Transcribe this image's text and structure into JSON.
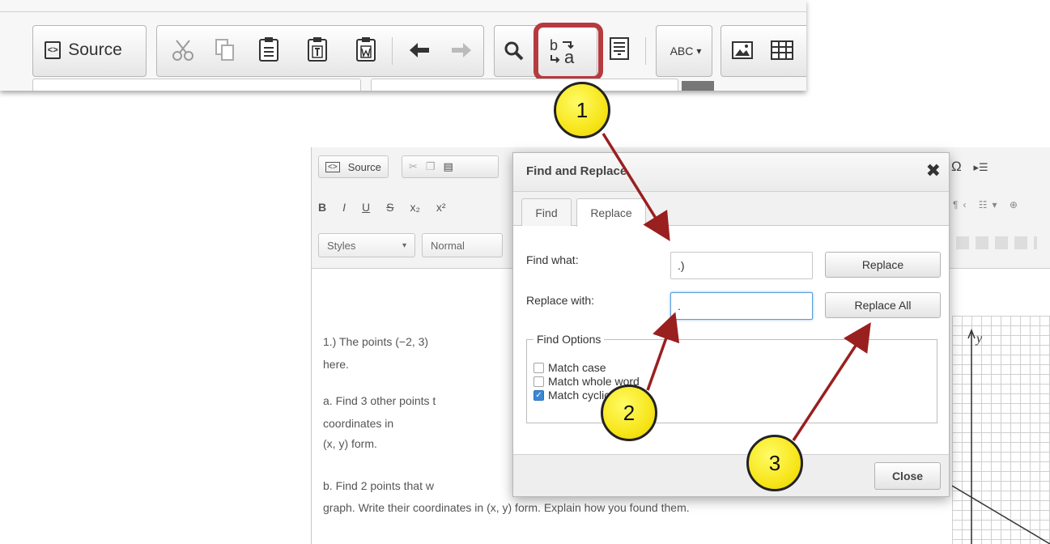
{
  "top_toolbar": {
    "source_label": "Source",
    "spell_label": "ABC"
  },
  "editor": {
    "source_label": "Source",
    "styles_label": "Styles",
    "format_label": "Normal",
    "format_row_letters": [
      "B",
      "I",
      "U",
      "S",
      "x₂",
      "x²"
    ],
    "omega": "Ω",
    "doc_lines": [
      "1.)        The points (−2, 3)",
      "here.",
      "a.        Find 3 other points t",
      "coordinates in",
      "(x, y) form.",
      "b.        Find 2 points that w",
      "graph. Write their coordinates in (x, y) form. Explain how you found them."
    ],
    "graph_axis_label": "y"
  },
  "dialog": {
    "title": "Find and Replace",
    "close_glyph": "✖",
    "tabs": [
      "Find",
      "Replace"
    ],
    "find_label": "Find what:",
    "find_value": ".)",
    "replace_label": "Replace with:",
    "replace_value": ".",
    "replace_button": "Replace",
    "replace_all_button": "Replace All",
    "options_legend": "Find Options",
    "options": [
      {
        "label": "Match case",
        "checked": false
      },
      {
        "label": "Match whole word",
        "checked": false
      },
      {
        "label": "Match cyclic",
        "checked": true
      }
    ],
    "close_button": "Close"
  },
  "callouts": [
    "1",
    "2",
    "3"
  ],
  "colors": {
    "arrow": "#9a1f1f",
    "highlight": "#b63a3f",
    "callout_fill": "#f7e61b"
  }
}
